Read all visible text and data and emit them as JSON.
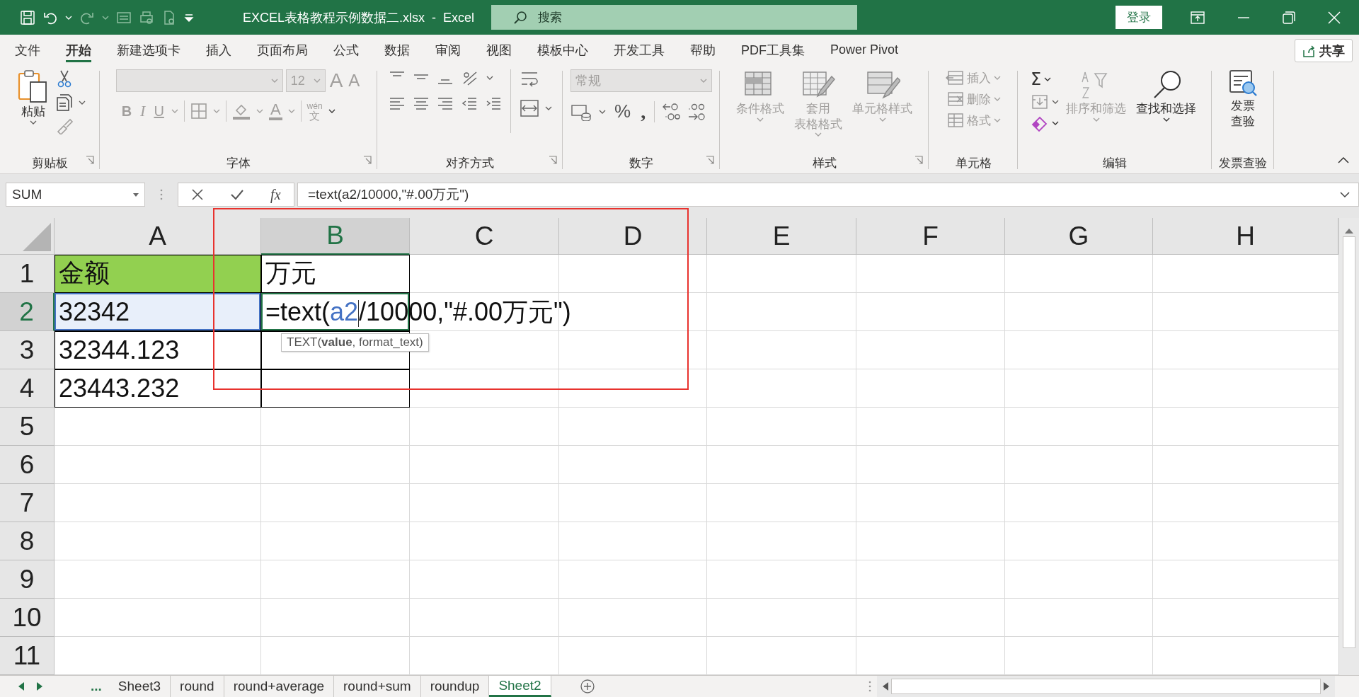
{
  "title_bar": {
    "document_title": "EXCEL表格教程示例数据二.xlsx  -  Excel",
    "search": {
      "placeholder": "搜索"
    },
    "login_button": "登录"
  },
  "ribbon_tabs": [
    {
      "label": "文件",
      "selected": false
    },
    {
      "label": "开始",
      "selected": true
    },
    {
      "label": "新建选项卡",
      "selected": false
    },
    {
      "label": "插入",
      "selected": false
    },
    {
      "label": "页面布局",
      "selected": false
    },
    {
      "label": "公式",
      "selected": false
    },
    {
      "label": "数据",
      "selected": false
    },
    {
      "label": "审阅",
      "selected": false
    },
    {
      "label": "视图",
      "selected": false
    },
    {
      "label": "模板中心",
      "selected": false
    },
    {
      "label": "开发工具",
      "selected": false
    },
    {
      "label": "帮助",
      "selected": false
    },
    {
      "label": "PDF工具集",
      "selected": false
    },
    {
      "label": "Power Pivot",
      "selected": false
    }
  ],
  "share_button": "共享",
  "ribbon_groups": [
    {
      "kind": "clipboard",
      "label": "剪贴板",
      "paste": {
        "lines": [
          "粘贴"
        ],
        "disabled": false
      }
    },
    {
      "kind": "font",
      "label": "字体",
      "disabled": true,
      "font_size": "12",
      "grow_font": "A",
      "shrink_font": "A",
      "bold": "B",
      "italic": "I",
      "underline": "U",
      "font_color": "A",
      "phonetic": "wén",
      "phonetic_base": "文"
    },
    {
      "kind": "alignment",
      "label": "对齐方式"
    },
    {
      "kind": "number",
      "label": "数字",
      "disabled": true,
      "number_format": "常规",
      "percent": "%",
      "comma": ","
    },
    {
      "kind": "styles",
      "label": "样式",
      "buttons": [
        {
          "lines": [
            "条件格式"
          ],
          "disabled": true
        },
        {
          "lines": [
            "套用",
            "表格格式"
          ],
          "disabled": true
        },
        {
          "lines": [
            "单元格样式"
          ],
          "disabled": true
        }
      ]
    },
    {
      "kind": "cells",
      "label": "单元格",
      "buttons": [
        {
          "label": "插入",
          "disabled": true
        },
        {
          "label": "删除",
          "disabled": true
        },
        {
          "label": "格式",
          "disabled": true
        }
      ]
    },
    {
      "kind": "editing",
      "label": "编辑",
      "sum": "Σ",
      "buttons": [
        {
          "lines": [
            "排序和筛选"
          ],
          "disabled": true
        },
        {
          "lines": [
            "查找和选择"
          ],
          "disabled": false
        }
      ]
    },
    {
      "kind": "invoice",
      "label": "发票查验",
      "button": {
        "lines": [
          "发票",
          "查验"
        ],
        "disabled": false
      }
    }
  ],
  "formula_bar": {
    "name_box": "SUM",
    "fx": "fx",
    "formula": "=text(a2/10000,\"#.00万元\")"
  },
  "sheet": {
    "columns": [
      {
        "label": "A",
        "selected": false
      },
      {
        "label": "B",
        "selected": true
      },
      {
        "label": "C",
        "selected": false
      },
      {
        "label": "D",
        "selected": false
      },
      {
        "label": "E",
        "selected": false
      },
      {
        "label": "F",
        "selected": false
      },
      {
        "label": "G",
        "selected": false
      },
      {
        "label": "H",
        "selected": false
      }
    ],
    "rows": [
      {
        "header": "1",
        "selected": false,
        "cells": [
          {
            "value": "金额",
            "color": "#92d050",
            "bordered": true,
            "referenced": false,
            "editing": false
          },
          {
            "value": "万元",
            "bordered": true,
            "referenced": false,
            "editing": false
          }
        ]
      },
      {
        "header": "2",
        "selected": true,
        "cells": [
          {
            "value": "32342",
            "bordered": true,
            "referenced": true,
            "editing": false
          },
          {
            "bordered": true,
            "referenced": false,
            "editing": true,
            "formula_parts": [
              {
                "text": "=text(",
                "ref": false
              },
              {
                "text": "a2",
                "ref": true
              },
              {
                "text": "/10000,\"#.00万元\")",
                "ref": false
              }
            ],
            "tooltip": "TEXT(**value**, format_text)"
          }
        ]
      },
      {
        "header": "3",
        "selected": false,
        "cells": [
          {
            "value": "32344.123",
            "bordered": true,
            "referenced": false,
            "editing": false
          },
          {
            "bordered": true,
            "referenced": false,
            "editing": false
          }
        ]
      },
      {
        "header": "4",
        "selected": false,
        "cells": [
          {
            "value": "23443.232",
            "bordered": true,
            "referenced": false,
            "editing": false
          },
          {
            "bordered": true,
            "referenced": false,
            "editing": false
          }
        ]
      },
      {
        "header": "5",
        "selected": false
      },
      {
        "header": "6",
        "selected": false
      },
      {
        "header": "7",
        "selected": false
      },
      {
        "header": "8",
        "selected": false
      },
      {
        "header": "9",
        "selected": false
      },
      {
        "header": "10",
        "selected": false
      },
      {
        "header": "11",
        "selected": false
      }
    ]
  },
  "sheet_tabs": {
    "more": "...",
    "tabs": [
      {
        "label": "Sheet3",
        "selected": false
      },
      {
        "label": "round",
        "selected": false
      },
      {
        "label": "round+average",
        "selected": false
      },
      {
        "label": "round+sum",
        "selected": false
      },
      {
        "label": "roundup",
        "selected": false
      },
      {
        "label": "Sheet2",
        "selected": true
      }
    ]
  }
}
